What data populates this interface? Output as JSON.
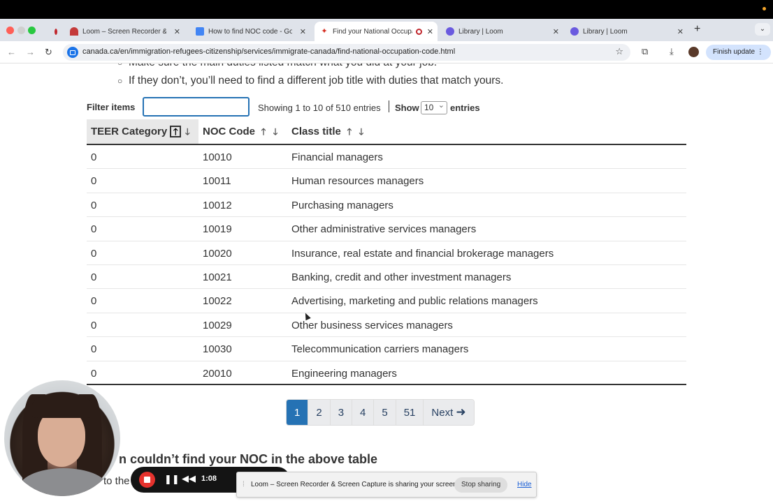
{
  "browser": {
    "tabs": [
      {
        "label": "Loom – Screen Recorder & Sc",
        "icon": "loom-icon",
        "active": false
      },
      {
        "label": "How to find NOC code - Goo",
        "icon": "docs-icon",
        "active": false
      },
      {
        "label": "Find your National Occupa",
        "icon": "canada-flag-icon",
        "active": true
      },
      {
        "label": "Library | Loom",
        "icon": "loom-icon",
        "active": false
      },
      {
        "label": "Library | Loom",
        "icon": "loom-icon",
        "active": false
      }
    ],
    "url": "canada.ca/en/immigration-refugees-citizenship/services/immigrate-canada/find-national-occupation-code.html",
    "finish_update": "Finish update"
  },
  "page": {
    "bullets": [
      "Make sure the main duties listed match what you did at your job.",
      "If they don’t, you’ll need to find a different job title with duties that match yours."
    ],
    "filter_label": "Filter items",
    "filter_value": "",
    "showing_text": "Showing 1 to 10 of 510 entries",
    "show_label": "Show",
    "show_value": "10",
    "entries_label": "entries",
    "columns": [
      "TEER Category",
      "NOC Code",
      "Class title"
    ],
    "rows": [
      {
        "teer": "0",
        "noc": "10010",
        "title": "Financial managers"
      },
      {
        "teer": "0",
        "noc": "10011",
        "title": "Human resources managers"
      },
      {
        "teer": "0",
        "noc": "10012",
        "title": "Purchasing managers"
      },
      {
        "teer": "0",
        "noc": "10019",
        "title": "Other administrative services managers"
      },
      {
        "teer": "0",
        "noc": "10020",
        "title": "Insurance, real estate and financial brokerage managers"
      },
      {
        "teer": "0",
        "noc": "10021",
        "title": "Banking, credit and other investment managers"
      },
      {
        "teer": "0",
        "noc": "10022",
        "title": "Advertising, marketing and public relations managers"
      },
      {
        "teer": "0",
        "noc": "10029",
        "title": "Other business services managers"
      },
      {
        "teer": "0",
        "noc": "10030",
        "title": "Telecommunication carriers managers"
      },
      {
        "teer": "0",
        "noc": "20010",
        "title": "Engineering managers"
      }
    ],
    "pagination": [
      "1",
      "2",
      "3",
      "4",
      "5",
      "51",
      "Next"
    ],
    "current_page": "1",
    "heading": "n couldn’t find your NOC in the above table",
    "sub_text": "to the"
  },
  "recorder": {
    "time": "1:08",
    "share_message": "Loom – Screen Recorder & Screen Capture is sharing your screen.",
    "stop_sharing": "Stop sharing",
    "hide": "Hide"
  }
}
